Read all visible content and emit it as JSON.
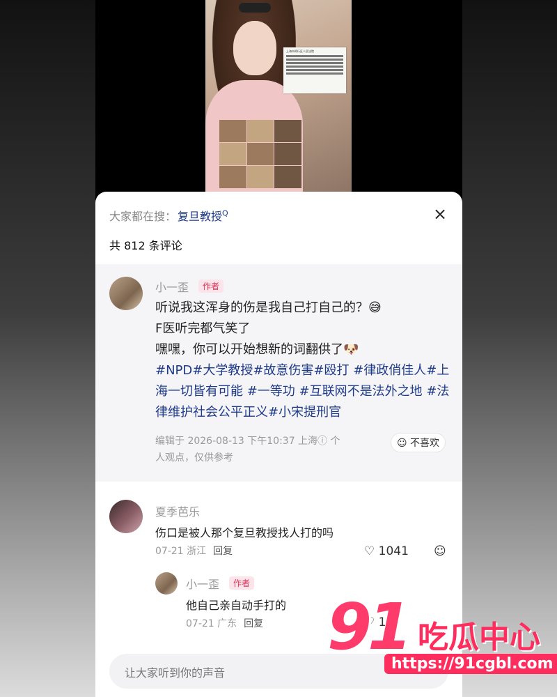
{
  "search": {
    "prefix": "大家都在搜：",
    "term": "复旦教授",
    "term_mark": "Q"
  },
  "comment_count_label": "共 812 条评论",
  "close_icon": "×",
  "pinned_comment": {
    "author": "小一歪",
    "badge": "作者",
    "line1": "听说我这浑身的伤是我自己打自己的？😅",
    "line2": "F医听完都气笑了",
    "line3": "嘿嘿，你可以开始想新的词翻供了🐶",
    "hashtags": "#NPD#大学教授#故意伤害#殴打 #律政俏佳人#上海一切皆有可能 #一等功 #互联网不是法外之地 #法律维护社会公平正义#小宋提刑官",
    "meta_line1": "编辑于 2026-08-13 下午10:37 上海ⓘ 个",
    "meta_line2": "人观点，仅供参考",
    "dislike_label": "☺ 不喜欢"
  },
  "comments": [
    {
      "author": "夏季芭乐",
      "text": "伤口是被人那个复旦教授找人打的吗",
      "date_loc": "07-21 浙江",
      "reply": "回复",
      "likes": "1041"
    }
  ],
  "reply": {
    "author": "小一歪",
    "badge": "作者",
    "text": "他自己亲自动手打的",
    "date_loc": "07-21 广东",
    "reply": "回复",
    "likes": "11"
  },
  "input_placeholder": "让大家听到你的声音",
  "video_doc_text": "上海市闵行区人民法院",
  "watermark": {
    "num": "91",
    "text": "吃瓜中心",
    "url": "https://91cgbl.com"
  },
  "icons": [
    "close-icon",
    "heart-icon",
    "emoji-icon"
  ]
}
